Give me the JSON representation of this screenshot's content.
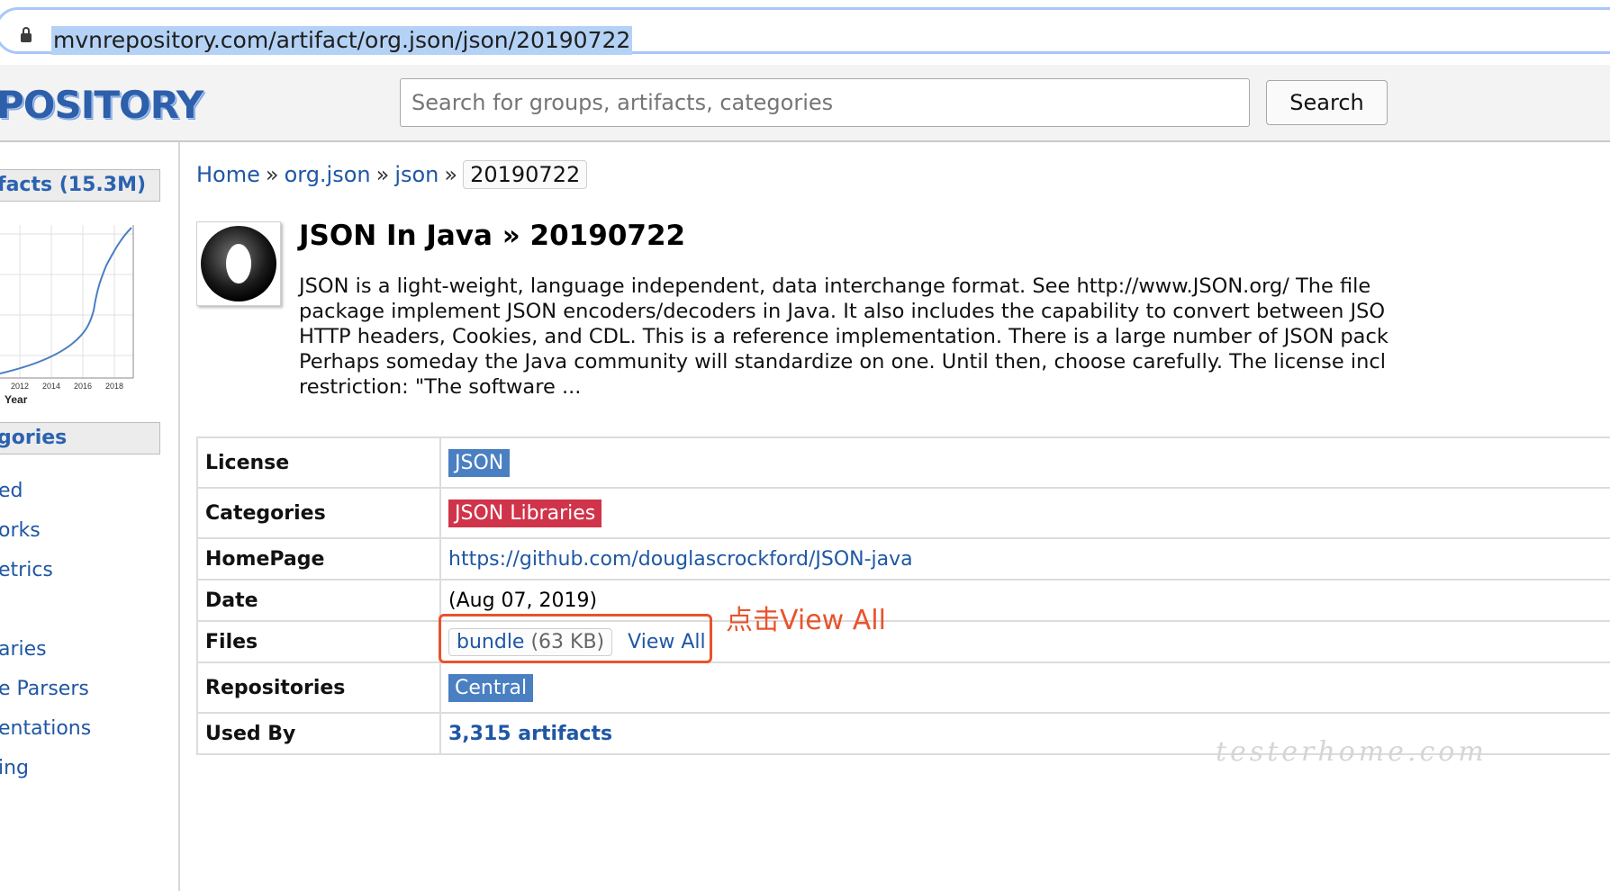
{
  "browser": {
    "url": "mvnrepository.com/artifact/org.json/json/20190722"
  },
  "header": {
    "logo_text": "POSITORY",
    "search_placeholder": "Search for groups, artifacts, categories",
    "search_button": "Search"
  },
  "sidebar": {
    "artifacts_heading": "facts (15.3M)",
    "chart": {
      "ticks": [
        "2012",
        "2014",
        "2016",
        "2018"
      ],
      "xlabel": "Year"
    },
    "categories_heading": "gories",
    "links": [
      "ed",
      "orks",
      "etrics",
      "aries",
      "e Parsers",
      "entations",
      "ing"
    ]
  },
  "breadcrumb": {
    "home": "Home",
    "group": "org.json",
    "artifact": "json",
    "version": "20190722",
    "sep": "»"
  },
  "title": "JSON In Java » 20190722",
  "description_lines": [
    "JSON is a light-weight, language independent, data interchange format. See http://www.JSON.org/ The file",
    "package implement JSON encoders/decoders in Java. It also includes the capability to convert between JSO",
    "HTTP headers, Cookies, and CDL. This is a reference implementation. There is a large number of JSON pack",
    "Perhaps someday the Java community will standardize on one. Until then, choose carefully. The license incl",
    "restriction: \"The software ..."
  ],
  "table": {
    "license_label": "License",
    "license_value": "JSON",
    "categories_label": "Categories",
    "categories_value": "JSON Libraries",
    "homepage_label": "HomePage",
    "homepage_value": "https://github.com/douglascrockford/JSON-java",
    "date_label": "Date",
    "date_value": "(Aug 07, 2019)",
    "files_label": "Files",
    "bundle_label": "bundle",
    "bundle_size": "(63 KB)",
    "view_all": "View All",
    "repositories_label": "Repositories",
    "repositories_value": "Central",
    "usedby_label": "Used By",
    "usedby_value": "3,315 artifacts"
  },
  "annotation": "点击View All",
  "watermark": "testerhome.com",
  "colors": {
    "link": "#1f57a4",
    "badge_blue": "#4a7fc2",
    "badge_red": "#d0344a",
    "annotation": "#e8532c"
  }
}
